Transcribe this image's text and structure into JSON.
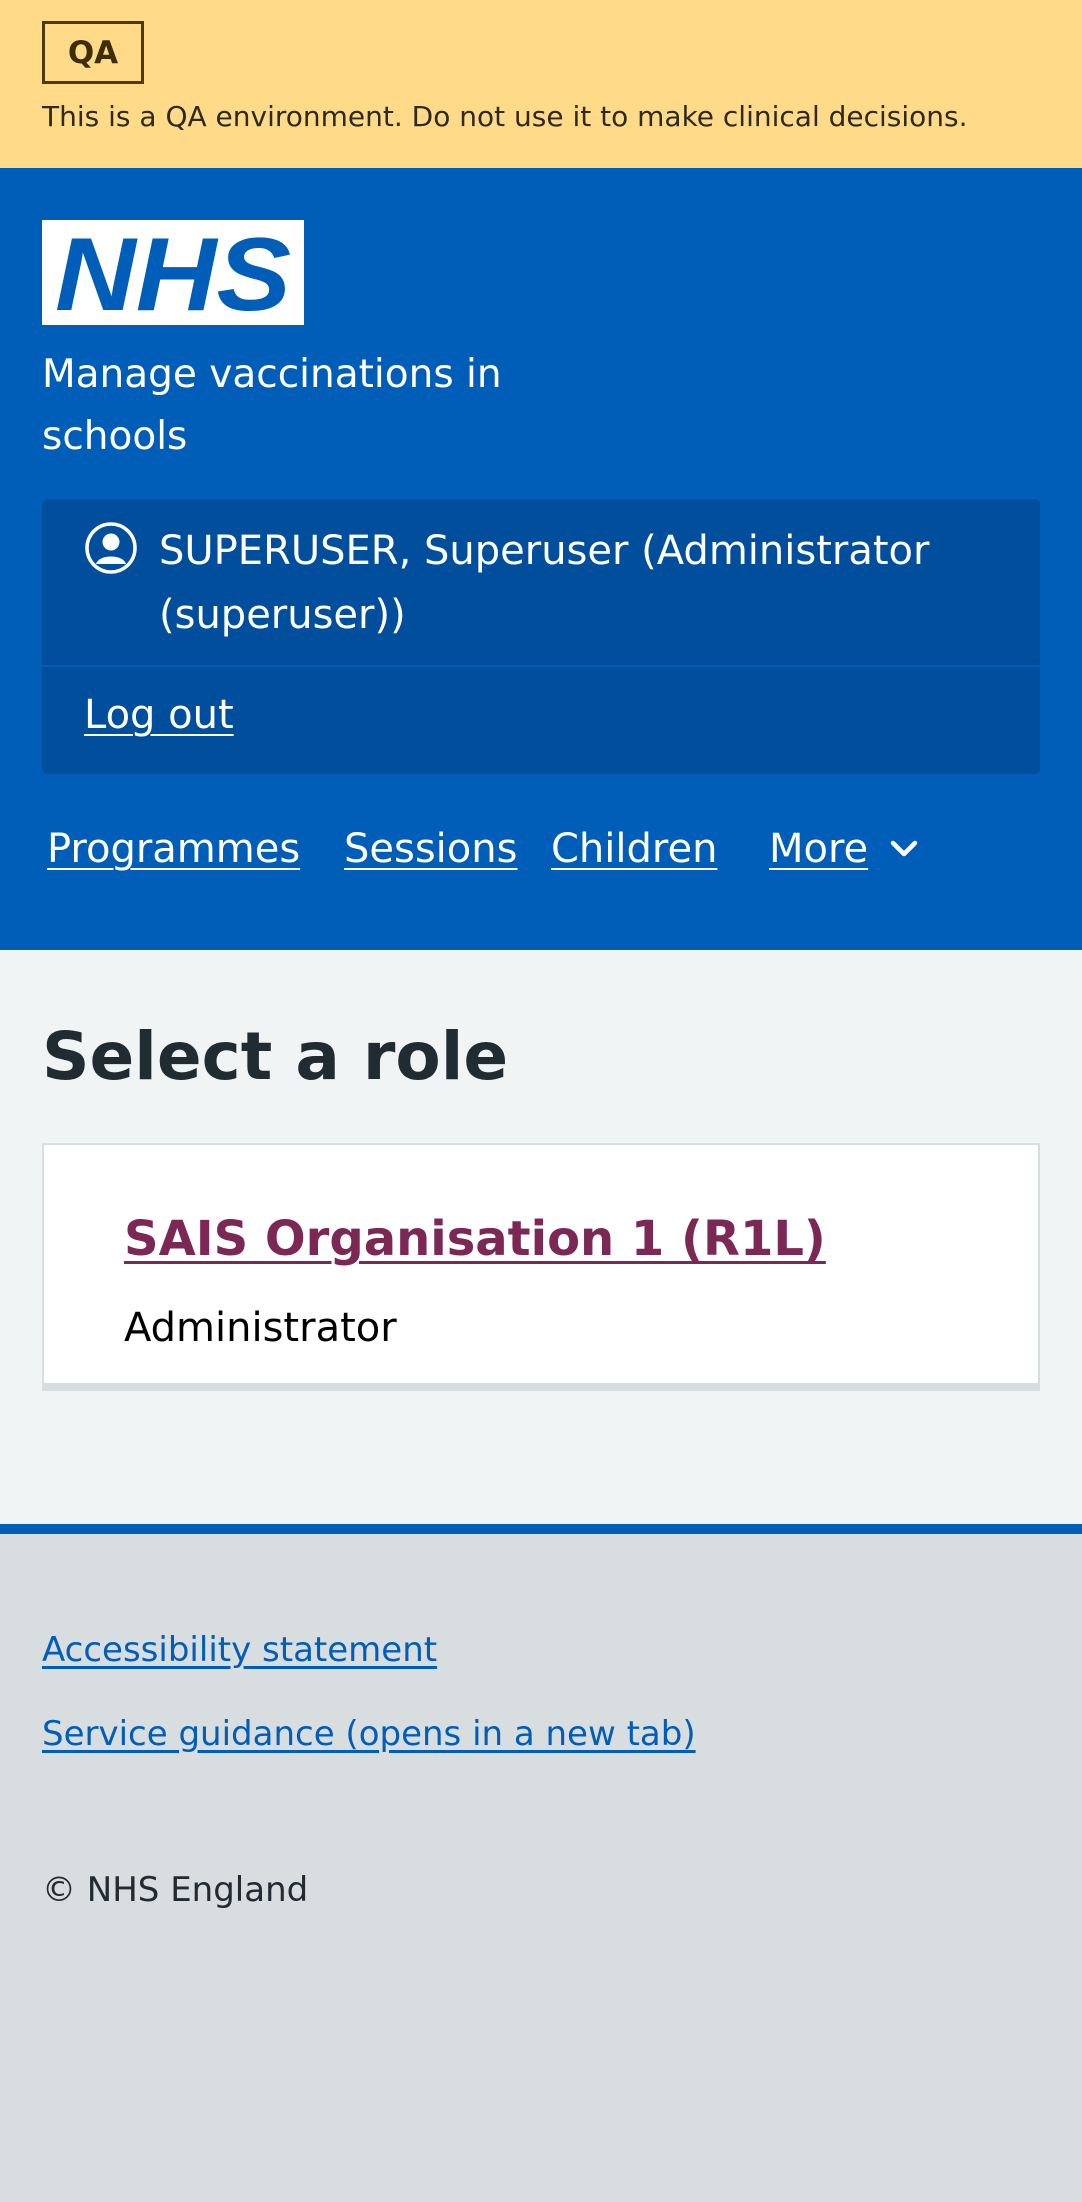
{
  "env_banner": {
    "tag": "QA",
    "message": "This is a QA environment. Do not use it to make clinical decisions.",
    "background": "#ffdb89"
  },
  "header": {
    "logo_text": "NHS",
    "service_name": "Manage vaccinations in schools",
    "account": {
      "icon": "user-circle-icon",
      "user_label": "SUPERUSER, Superuser (Administrator (superuser))",
      "logout_label": "Log out"
    },
    "nav": [
      {
        "label": "Programmes"
      },
      {
        "label": "Sessions"
      },
      {
        "label": "Children"
      },
      {
        "label": "More",
        "icon": "chevron-down-icon"
      }
    ],
    "brand_color": "#005eb8"
  },
  "main": {
    "title": "Select a role",
    "roles": [
      {
        "organisation": "SAIS Organisation 1 (R1L)",
        "role": "Administrator",
        "link_color": "#7c2855"
      }
    ]
  },
  "footer": {
    "links": [
      {
        "label": "Accessibility statement"
      },
      {
        "label": "Service guidance (opens in a new tab)"
      }
    ],
    "copyright": "© NHS England"
  }
}
